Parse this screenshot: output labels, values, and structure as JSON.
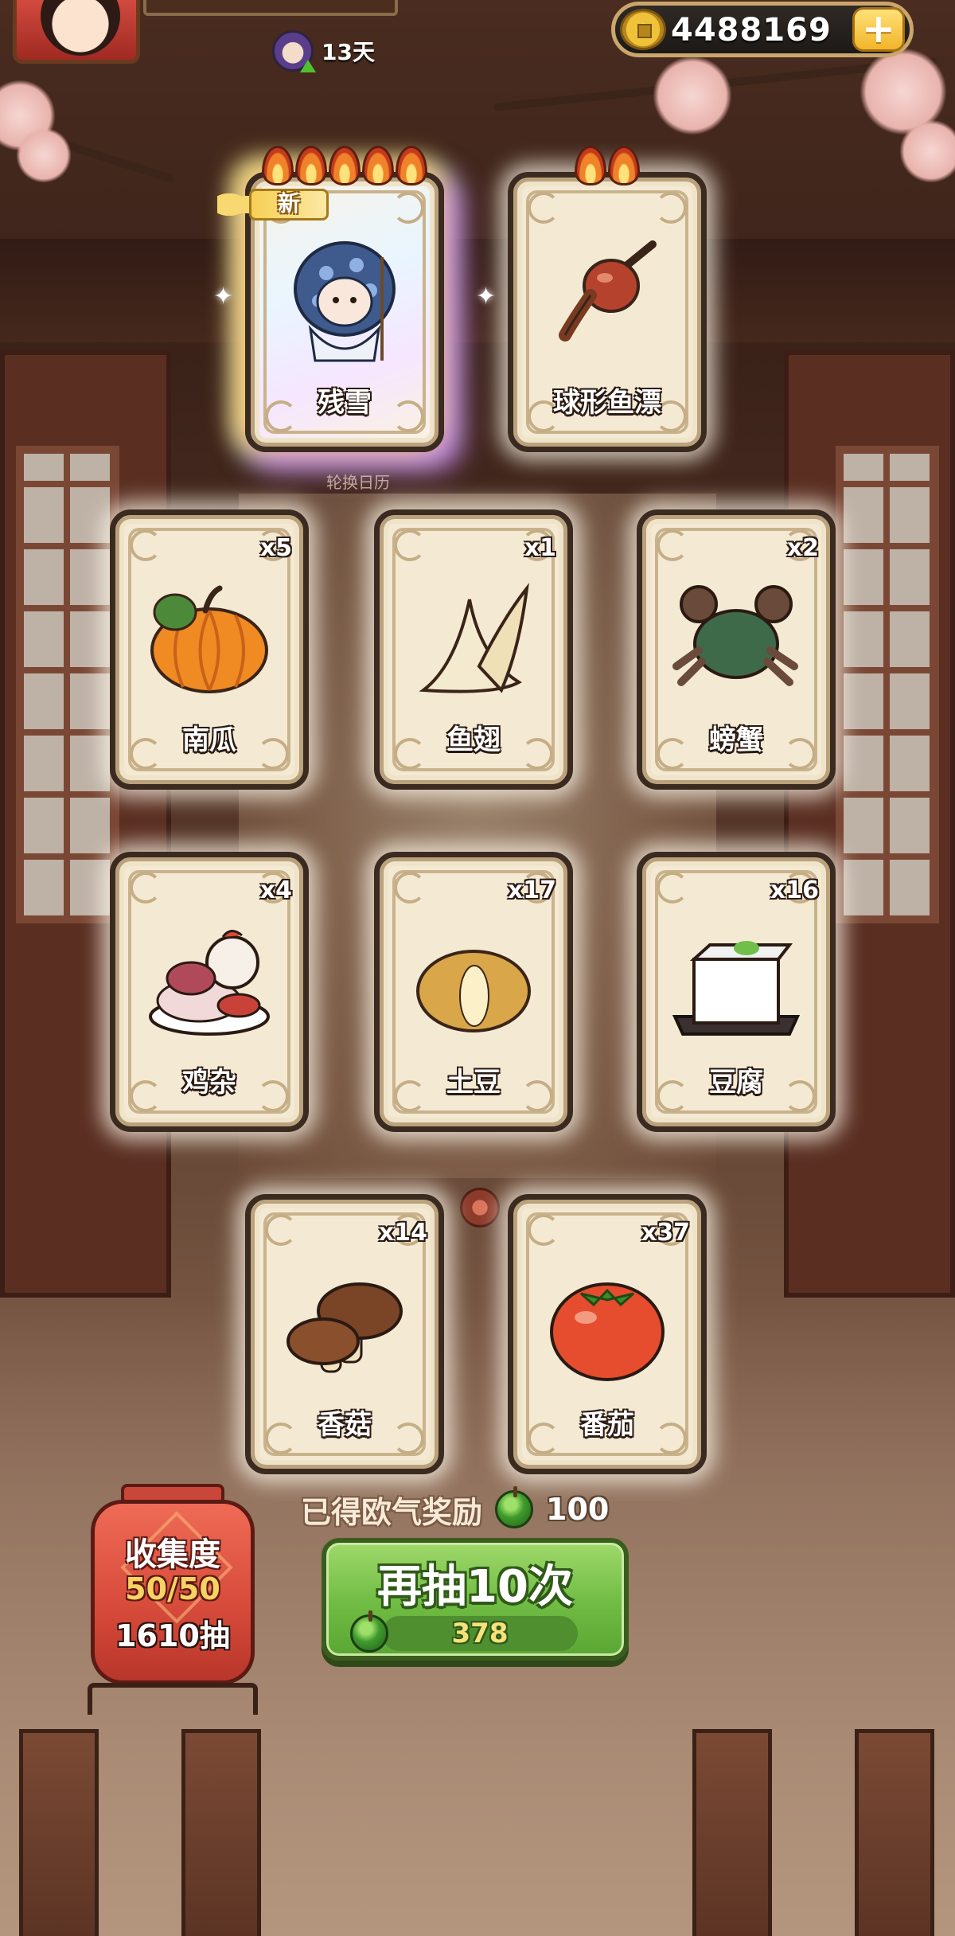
{
  "topbar": {
    "days": "13天",
    "coins": "4488169",
    "add": "+"
  },
  "new_badge": "新",
  "under_text": "轮换日历",
  "cards": [
    {
      "name": "残雪",
      "count": "",
      "flames": 5,
      "rare": true
    },
    {
      "name": "球形鱼漂",
      "count": "",
      "flames": 2,
      "rare": false
    },
    {
      "name": "南瓜",
      "count": "x5"
    },
    {
      "name": "鱼翅",
      "count": "x1"
    },
    {
      "name": "螃蟹",
      "count": "x2"
    },
    {
      "name": "鸡杂",
      "count": "x4"
    },
    {
      "name": "土豆",
      "count": "x17"
    },
    {
      "name": "豆腐",
      "count": "x16"
    },
    {
      "name": "香菇",
      "count": "x14"
    },
    {
      "name": "番茄",
      "count": "x37"
    }
  ],
  "reward": {
    "label": "已得欧气奖励",
    "value": "100"
  },
  "draw_button": {
    "label": "再抽10次",
    "cost": "378"
  },
  "collection": {
    "title": "收集度",
    "progress": "50/50",
    "draws": "1610抽"
  },
  "colors": {
    "button_green": "#6fbb43",
    "lantern_red": "#d64a3a",
    "card_bg": "#f4ead4",
    "coin_border": "#c9a66b"
  }
}
